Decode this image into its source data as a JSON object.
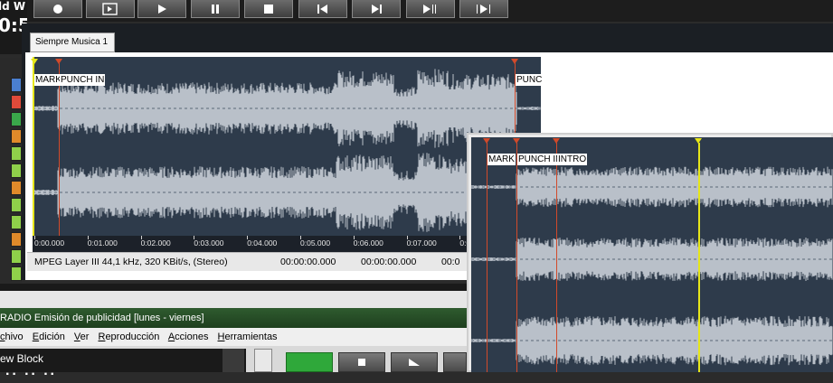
{
  "top_clock": {
    "line1": "ld W",
    "line2": "0:5"
  },
  "toolbar": {
    "buttons": [
      {
        "name": "record-button",
        "icon": "record-icon"
      },
      {
        "name": "play-from-cue-button",
        "icon": "play-frame-icon"
      },
      {
        "name": "play-button",
        "icon": "play-icon"
      },
      {
        "name": "pause-button",
        "icon": "pause-icon"
      },
      {
        "name": "stop-button",
        "icon": "stop-icon"
      },
      {
        "name": "skip-back-button",
        "icon": "skip-back-icon"
      },
      {
        "name": "skip-forward-button",
        "icon": "skip-forward-icon"
      },
      {
        "name": "play-to-mark-button",
        "icon": "play-to-mark-icon"
      },
      {
        "name": "play-from-mark-button",
        "icon": "play-from-mark-icon"
      }
    ]
  },
  "editor1": {
    "tab_label": "Siempre Musica 1",
    "markers": [
      {
        "label": "MARK"
      },
      {
        "label": "PUNCH IN"
      },
      {
        "label": "PUNC"
      }
    ],
    "timeline": [
      "0:00.000",
      "0:01.000",
      "0:02.000",
      "0:03.000",
      "0:04.000",
      "0:05.000",
      "0:06.000",
      "0:07.000",
      "0:0"
    ],
    "status": {
      "format": "MPEG Layer III 44,1 kHz, 320 KBit/s, (Stereo)",
      "time1": "00:00:00.000",
      "time2": "00:00:00.000",
      "time3": "00:0"
    }
  },
  "editor2": {
    "markers": [
      {
        "label": "MARK"
      },
      {
        "label": "PUNCH IN"
      },
      {
        "label": "INTRO"
      }
    ]
  },
  "app_window": {
    "title": "RADIO Emisión de publicidad [lunes - viernes]",
    "menu": [
      {
        "label": "chivo",
        "underline": "c"
      },
      {
        "label": "Edición",
        "underline": "E"
      },
      {
        "label": "Ver",
        "underline": "V"
      },
      {
        "label": "Reproducción",
        "underline": "R"
      },
      {
        "label": "Acciones",
        "underline": "A"
      },
      {
        "label": "Herramientas",
        "underline": "H"
      }
    ],
    "block_label": "ew Block"
  },
  "colors": {
    "wave_bg": "#2e3b4b",
    "wave_fg": "#b9c0c9",
    "marker": "#d24a2a",
    "playhead": "#e6e619",
    "title_green": "#2f5b2f"
  }
}
